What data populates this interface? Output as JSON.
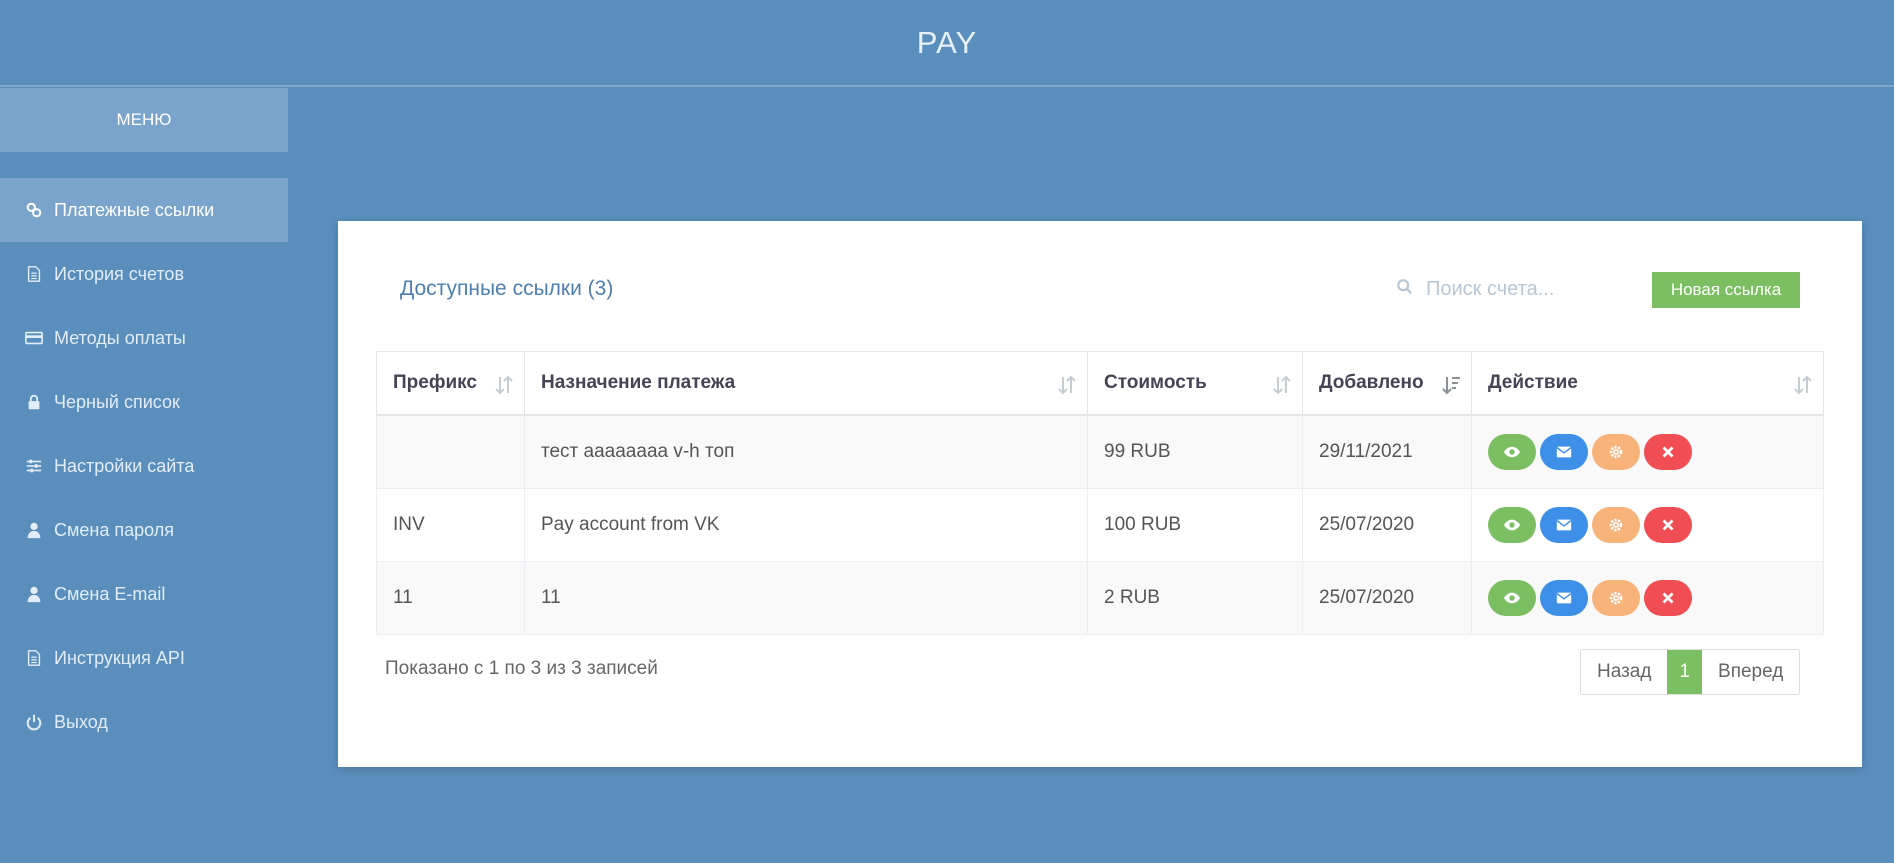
{
  "header": {
    "title": "PAY"
  },
  "sidebar": {
    "menu_label": "МЕНЮ",
    "items": [
      {
        "label": "Платежные ссылки",
        "icon": "link-icon",
        "active": true
      },
      {
        "label": "История счетов",
        "icon": "document-icon"
      },
      {
        "label": "Методы оплаты",
        "icon": "credit-card-icon"
      },
      {
        "label": "Черный список",
        "icon": "lock-icon"
      },
      {
        "label": "Настройки сайта",
        "icon": "sliders-icon"
      },
      {
        "label": "Смена пароля",
        "icon": "user-icon"
      },
      {
        "label": "Смена E-mail",
        "icon": "user-icon"
      },
      {
        "label": "Инструкция API",
        "icon": "document-icon"
      },
      {
        "label": "Выход",
        "icon": "power-icon"
      }
    ]
  },
  "main": {
    "title": "Доступные ссылки (3)",
    "search": {
      "placeholder": "Поиск счета...",
      "value": ""
    },
    "new_button": "Новая ссылка",
    "table": {
      "columns": [
        "Префикс",
        "Назначение платежа",
        "Стоимость",
        "Добавлено",
        "Действие"
      ],
      "rows": [
        {
          "prefix": "",
          "purpose": "тест ааааааaa v-h топ",
          "price": "99 RUB",
          "added": "29/11/2021"
        },
        {
          "prefix": "INV",
          "purpose": "Pay account from VK",
          "price": "100 RUB",
          "added": "25/07/2020"
        },
        {
          "prefix": "11",
          "purpose": "11",
          "price": "2 RUB",
          "added": "25/07/2020"
        }
      ]
    },
    "footer": {
      "info": "Показано с 1 по 3 из 3 записей",
      "prev": "Назад",
      "page": "1",
      "next": "Вперед"
    }
  },
  "colors": {
    "background": "#5a8ebd",
    "active_nav": "#7ba4cc",
    "success": "#7cbf62",
    "info": "#3d8fe8",
    "warning": "#f8b37a",
    "danger": "#f04d55"
  }
}
